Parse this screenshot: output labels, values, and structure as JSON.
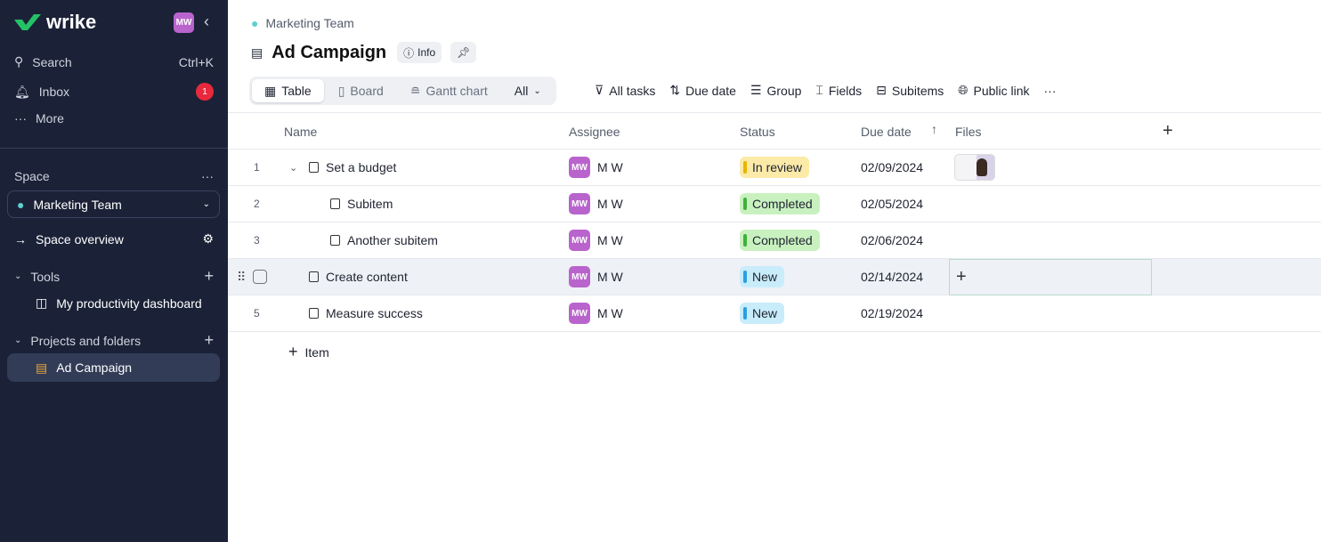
{
  "sidebar": {
    "logo": "wrike",
    "avatar": "MW",
    "search": "Search",
    "search_shortcut": "Ctrl+K",
    "inbox": "Inbox",
    "inbox_count": "1",
    "more": "More",
    "space_label": "Space",
    "space_name": "Marketing Team",
    "space_overview": "Space overview",
    "tools": "Tools",
    "dashboard": "My productivity dashboard",
    "projects": "Projects and folders",
    "active_project": "Ad Campaign"
  },
  "header": {
    "breadcrumb": "Marketing Team",
    "title": "Ad Campaign",
    "info": "Info"
  },
  "views": {
    "table": "Table",
    "board": "Board",
    "gantt": "Gantt chart",
    "all": "All"
  },
  "toolbar": {
    "all_tasks": "All tasks",
    "due_date": "Due date",
    "group": "Group",
    "fields": "Fields",
    "subitems": "Subitems",
    "public_link": "Public link"
  },
  "columns": {
    "name": "Name",
    "assignee": "Assignee",
    "status": "Status",
    "due": "Due date",
    "files": "Files"
  },
  "rows": [
    {
      "num": "1",
      "name": "Set a budget",
      "avatar": "MW",
      "assignee": "M W",
      "status": "In review",
      "due": "02/09/2024"
    },
    {
      "num": "2",
      "name": "Subitem",
      "avatar": "MW",
      "assignee": "M W",
      "status": "Completed",
      "due": "02/05/2024"
    },
    {
      "num": "3",
      "name": "Another subitem",
      "avatar": "MW",
      "assignee": "M W",
      "status": "Completed",
      "due": "02/06/2024"
    },
    {
      "num": "",
      "name": "Create content",
      "avatar": "MW",
      "assignee": "M W",
      "status": "New",
      "due": "02/14/2024"
    },
    {
      "num": "5",
      "name": "Measure success",
      "avatar": "MW",
      "assignee": "M W",
      "status": "New",
      "due": "02/19/2024"
    }
  ],
  "add_item": "Item",
  "colors": {
    "sidebar": "#1b2237",
    "brand": "#25c167",
    "in_review": "#fbeaa8",
    "completed": "#c9f1c0",
    "new": "#c9ecfb"
  }
}
